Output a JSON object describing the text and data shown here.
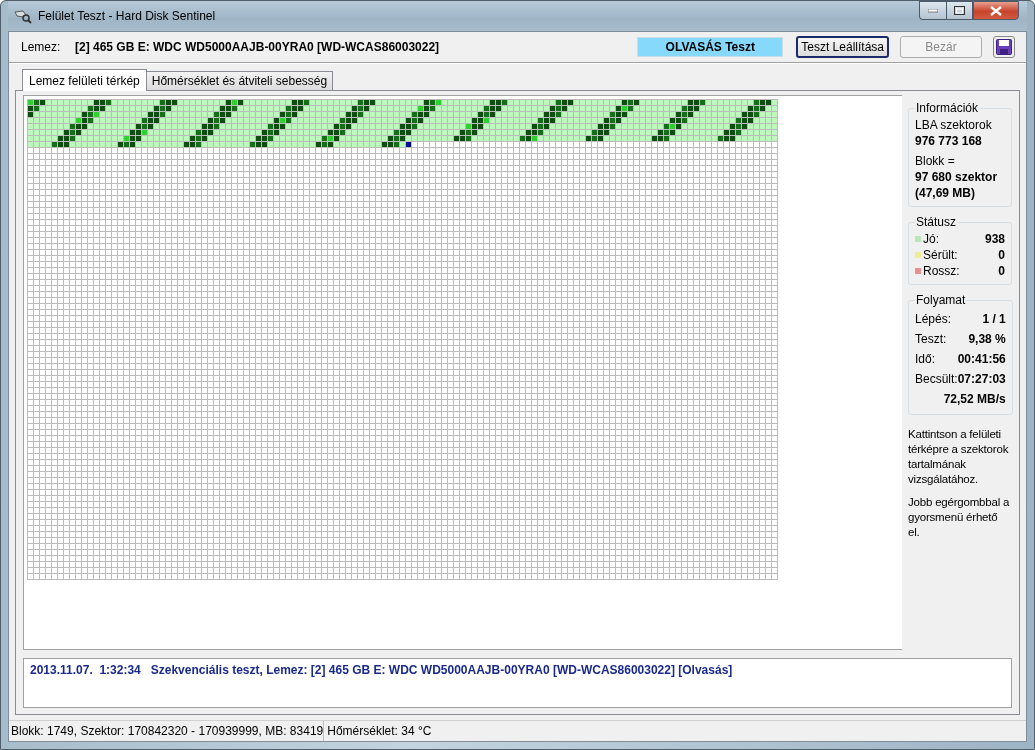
{
  "window": {
    "title": "Felület Teszt - Hard Disk Sentinel"
  },
  "disk": {
    "label": "Lemez:",
    "value": "[2] 465 GB E: WDC WD5000AAJB-00YRA0 [WD-WCAS86003022]"
  },
  "test_mode": "OLVASÁS Teszt",
  "buttons": [
    {
      "label": "Teszt Leállítása",
      "disabled": false
    },
    {
      "label": "Bezár",
      "disabled": true
    }
  ],
  "tabs": [
    {
      "label": "Lemez felületi térkép",
      "selected": true
    },
    {
      "label": "Hőmérséklet és átviteli sebesség",
      "selected": false
    }
  ],
  "surface_map": {
    "rows": [
      {
        "level": 1
      },
      {
        "level": 1
      },
      {
        "level": 1
      },
      {
        "level": 1
      },
      {
        "level": 1
      },
      {
        "level": 1
      },
      {
        "level": 1
      },
      {
        "level": 0.504
      }
    ]
  },
  "info": {
    "title": "Információk",
    "lines": [
      {
        "text": "LBA szektorok",
        "kind": "label"
      },
      {
        "text": "976 773 168",
        "kind": "value"
      },
      {
        "text": "Blokk =",
        "kind": "label"
      },
      {
        "text": "97 680 szektor",
        "kind": "value"
      },
      {
        "text": "(47,69 MB)",
        "kind": "value"
      }
    ]
  },
  "status": {
    "title": "Státusz",
    "items": [
      {
        "label": "Jó:",
        "value": "938",
        "color": "#b9e6b9"
      },
      {
        "label": "Sérült:",
        "value": "0",
        "color": "#eeee99"
      },
      {
        "label": "Rossz:",
        "value": "0",
        "color": "#e89090"
      }
    ]
  },
  "progress": {
    "title": "Folyamat",
    "rows": [
      {
        "label": "Lépés:",
        "value": "1 / 1"
      },
      {
        "label": "Teszt:",
        "value": "9,38 %"
      },
      {
        "label": "Idő:",
        "value": "00:41:56"
      },
      {
        "label": "Becsült:",
        "value": "07:27:03"
      },
      {
        "value": "72,52 MB/s"
      }
    ]
  },
  "hints": [
    "Kattintson a felületi térképre a szektorok tartalmának vizsgálatához.",
    "Jobb egérgombbal a gyorsmenü érhető el."
  ],
  "log": [
    {
      "time": "2013.11.07.  1:32:34",
      "message": "Szekvenciális teszt, Lemez: [2] 465 GB E: WDC WD5000AAJB-00YRA0 [WD-WCAS86003022] [Olvasás]"
    }
  ],
  "status_bar": [
    "Blokk: 1749, Szektor: 170842320 - 170939999, MB: 83419",
    "Hőmérséklet: 34  °C"
  ]
}
